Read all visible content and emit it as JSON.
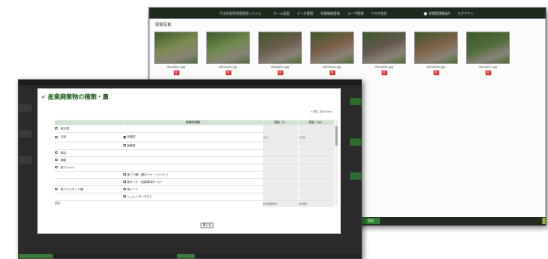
{
  "back_window": {
    "header": {
      "app_title": "不法投棄等現場管理システム",
      "nav": [
        "ホーム画面",
        "データ管理",
        "現場情報登録",
        "ユーザ管理",
        "マスタ設定"
      ],
      "user_name": "現場管理職員A",
      "logout": "ログアウト"
    },
    "section_title": "現場写真",
    "photos": [
      {
        "caption": "IMG0001.jpg",
        "tone": "#7c8b52"
      },
      {
        "caption": "IMG0002.jpg",
        "tone": "#6f8a4e"
      },
      {
        "caption": "IMG0003.jpg",
        "tone": "#6a5b4c"
      },
      {
        "caption": "IMG0004.jpg",
        "tone": "#7a5d48"
      },
      {
        "caption": "IMG0005.jpg",
        "tone": "#62574d"
      },
      {
        "caption": "IMG0006.jpg",
        "tone": "#7e6048"
      },
      {
        "caption": "IMG0007.jpg",
        "tone": "#4f6b3a"
      }
    ],
    "delete_symbol": "×",
    "footer_button": "保存"
  },
  "modal": {
    "title": "産業廃棄物の種類・量",
    "close_text": "× 閉じる(Close)",
    "columns": [
      "",
      "",
      "廃棄物種類",
      "数量（t）",
      "重量（kg）"
    ],
    "rows": [
      {
        "label": "燃え殻",
        "check": false,
        "opt": "",
        "opt_check": false,
        "v1": "",
        "v2": ""
      },
      {
        "label": "汚泥",
        "check": false,
        "opt": "有機性",
        "opt_check": true,
        "v1": "1.5",
        "v2": "1.50"
      },
      {
        "label": "",
        "check": false,
        "opt": "無機性",
        "opt_check": false,
        "v1": "",
        "v2": ""
      },
      {
        "label": "廃油",
        "check": false,
        "opt": "",
        "opt_check": false,
        "v1": "",
        "v2": ""
      },
      {
        "label": "廃酸",
        "check": false,
        "opt": "",
        "opt_check": false,
        "v1": "",
        "v2": ""
      },
      {
        "label": "廃アルカリ",
        "check": false,
        "opt": "",
        "opt_check": false,
        "v1": "",
        "v2": ""
      },
      {
        "label": "",
        "check": false,
        "opt": "廃プラ類（廃タイヤ・バンパー）",
        "opt_check": false,
        "v1": "",
        "v2": ""
      },
      {
        "label": "",
        "check": false,
        "opt": "廃タイヤ（自動車用タイヤ）",
        "opt_check": false,
        "v1": "",
        "v2": ""
      },
      {
        "label": "廃プラスチック類",
        "check": false,
        "opt": "廃シート",
        "opt_check": false,
        "v1": "",
        "v2": ""
      },
      {
        "label": "",
        "check": false,
        "opt": "シュレッダーダスト",
        "opt_check": false,
        "v1": "",
        "v2": ""
      }
    ],
    "total_label": "合計",
    "total_v1": "0.000000",
    "total_v2": "0.000",
    "ok_button": "閉じる"
  },
  "front_window": {
    "note": "※ 一覧に戻る"
  }
}
